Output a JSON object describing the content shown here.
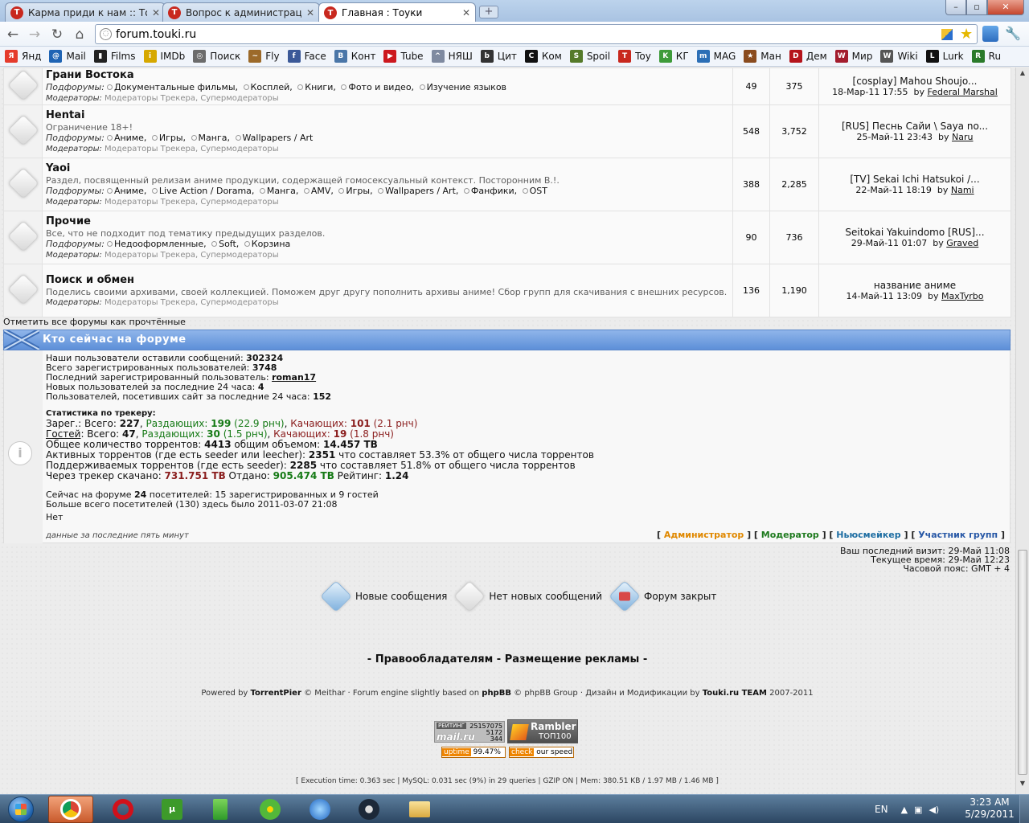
{
  "browser": {
    "tabs": [
      {
        "title": "Карма приди к нам :: То...",
        "favicon": "T"
      },
      {
        "title": "Вопрос к администраци...",
        "favicon": "T"
      },
      {
        "title": "Главная : Тоуки",
        "favicon": "T"
      }
    ],
    "new_tab": "+",
    "window_buttons": {
      "minimize": "–",
      "maximize": "▫",
      "close": "✕"
    },
    "nav": {
      "back": "←",
      "forward": "→",
      "reload": "↻",
      "home": "⌂"
    },
    "address": "forum.touki.ru",
    "bookmarks": [
      {
        "label": "Янд",
        "icon": "Я",
        "color": "#e53b2c"
      },
      {
        "label": "Mail",
        "icon": "@",
        "color": "#1f64b4"
      },
      {
        "label": "Films",
        "icon": "▮",
        "color": "#222222"
      },
      {
        "label": "IMDb",
        "icon": "i",
        "color": "#d6a800"
      },
      {
        "label": "Поиск",
        "icon": "◎",
        "color": "#6c6c6c"
      },
      {
        "label": "Fly",
        "icon": "~",
        "color": "#9c6a2a"
      },
      {
        "label": "Face",
        "icon": "f",
        "color": "#3b5998"
      },
      {
        "label": "Конт",
        "icon": "В",
        "color": "#4a76a8"
      },
      {
        "label": "Tube",
        "icon": "▶",
        "color": "#cc181e"
      },
      {
        "label": "НЯШ",
        "icon": "^",
        "color": "#7f8aa0"
      },
      {
        "label": "Цит",
        "icon": "b",
        "color": "#333333"
      },
      {
        "label": "Ком",
        "icon": "C",
        "color": "#111111"
      },
      {
        "label": "Spoil",
        "icon": "S",
        "color": "#557a2a"
      },
      {
        "label": "Toy",
        "icon": "T",
        "color": "#c8281e"
      },
      {
        "label": "КГ",
        "icon": "K",
        "color": "#3e9b3a"
      },
      {
        "label": "MAG",
        "icon": "m",
        "color": "#2c6fb6"
      },
      {
        "label": "Ман",
        "icon": "★",
        "color": "#8a4b1e"
      },
      {
        "label": "Дем",
        "icon": "D",
        "color": "#b5141b"
      },
      {
        "label": "Мир",
        "icon": "W",
        "color": "#a31d2e"
      },
      {
        "label": "Wiki",
        "icon": "W",
        "color": "#555555"
      },
      {
        "label": "Lurk",
        "icon": "L",
        "color": "#111111"
      },
      {
        "label": "Ru",
        "icon": "R",
        "color": "#2a7a2a"
      }
    ]
  },
  "forums": [
    {
      "title": "Грани Востока",
      "desc": "",
      "subforums_label": "Подфорумы:",
      "subforums": [
        "Документальные фильмы,",
        "Косплей,",
        "Книги,",
        "Фото и видео,",
        "Изучение языков"
      ],
      "mods_label": "Модераторы:",
      "mods": "Модераторы Трекера, Супермодераторы",
      "topics": "49",
      "posts": "375",
      "last_title": "[cosplay] Mahou Shoujo...",
      "last_date": "18-Мар-11 17:55",
      "by": "by",
      "last_user": "Federal Marshal"
    },
    {
      "title": "Hentai",
      "desc": "Ограничение 18+!",
      "subforums_label": "Подфорумы:",
      "subforums": [
        "Аниме,",
        "Игры,",
        "Манга,",
        "Wallpapers / Art"
      ],
      "mods_label": "Модераторы:",
      "mods": "Модераторы Трекера, Супермодераторы",
      "topics": "548",
      "posts": "3,752",
      "last_title": "[RUS] Песнь Сайи \\ Saya no...",
      "last_date": "25-Май-11 23:43",
      "by": "by",
      "last_user": "Naru"
    },
    {
      "title": "Yaoi",
      "desc": "Раздел, посвященный релизам аниме продукции, содержащей гомосексуальный контекст. Посторонним В.!.",
      "subforums_label": "Подфорумы:",
      "subforums": [
        "Аниме,",
        "Live Action / Dorama,",
        "Манга,",
        "AMV,",
        "Игры,",
        "Wallpapers / Art,",
        "Фанфики,",
        "OST"
      ],
      "mods_label": "Модераторы:",
      "mods": "Модераторы Трекера, Супермодераторы",
      "topics": "388",
      "posts": "2,285",
      "last_title": "[TV] Sekai Ichi Hatsukoi /...",
      "last_date": "22-Май-11 18:19",
      "by": "by",
      "last_user": "Nami"
    },
    {
      "title": "Прочие",
      "desc": "Все, что не подходит под тематику предыдущих разделов.",
      "subforums_label": "Подфорумы:",
      "subforums": [
        "Недооформленные,",
        "Soft,",
        "Корзина"
      ],
      "mods_label": "Модераторы:",
      "mods": "Модераторы Трекера, Супермодераторы",
      "topics": "90",
      "posts": "736",
      "last_title": "Seitokai Yakuindomo [RUS]...",
      "last_date": "29-Май-11 01:07",
      "by": "by",
      "last_user": "Graved"
    },
    {
      "title": "Поиск и обмен",
      "desc": "Поделись своими архивами, своей коллекцией. Поможем друг другу пополнить архивы аниме! Сбор групп для скачивания с внешних ресурсов.",
      "subforums_label": "",
      "subforums": [],
      "mods_label": "Модераторы:",
      "mods": "Модераторы Трекера, Супермодераторы",
      "topics": "136",
      "posts": "1,190",
      "last_title": "название аниме",
      "last_date": "14-Май-11 13:09",
      "by": "by",
      "last_user": "MaxTyrbo"
    }
  ],
  "mark_all_read": "Отметить все форумы как прочтённые",
  "online": {
    "header": "Кто сейчас на форуме",
    "stats": [
      {
        "label": "Наши пользователи оставили сообщений: ",
        "value": "302324"
      },
      {
        "label": "Всего зарегистрированных пользователей: ",
        "value": "3748"
      },
      {
        "label": "Последний зарегистрированный пользователь: ",
        "value": "roman17"
      },
      {
        "label": "Новых пользователей за последние 24 часа: ",
        "value": "4"
      },
      {
        "label": "Пользователей, посетивших сайт за последние 24 часа: ",
        "value": "152"
      }
    ],
    "tracker_title": "Статистика по трекеру:",
    "reg": {
      "label": "Зарег.:",
      "total_label": " Всего: ",
      "total": "227",
      "seed_label": "Раздающих: ",
      "seed": "199",
      "seed_rate": "(22.9 рнч)",
      "leech_label": "Качающих: ",
      "leech": "101",
      "leech_rate": "(2.1 рнч)"
    },
    "guests": {
      "label": "Гостей",
      "total_label": ": Всего: ",
      "total": "47",
      "seed_label": "Раздающих: ",
      "seed": "30",
      "seed_rate": "(1.5 рнч)",
      "leech_label": "Качающих: ",
      "leech": "19",
      "leech_rate": "(1.8 рнч)"
    },
    "torrents": {
      "label": "Общее количество торрентов: ",
      "value": "4413",
      "volume_label": " общим объемом: ",
      "volume": "14.457 TB"
    },
    "active": {
      "label": "Активных торрентов (где есть seeder или leecher): ",
      "value": "2351",
      "rest": " что составляет 53.3% от общего числа торрентов"
    },
    "seeded": {
      "label": "Поддерживаемых торрентов (где есть seeder): ",
      "value": "2285",
      "rest": " что составляет 51.8% от общего числа торрентов"
    },
    "traffic": {
      "down_label": "Через трекер скачано: ",
      "down": "731.751 TB",
      "up_label": " Отдано: ",
      "up": "905.474 TB",
      "ratio_label": " Рейтинг: ",
      "ratio": "1.24"
    },
    "now_label": "Сейчас на форуме ",
    "now_count": "24",
    "now_rest": " посетителей: 15 зарегистрированных и 9 гостей",
    "max": "Больше всего посетителей (130) здесь было 2011-03-07 21:08",
    "none": "Нет",
    "last5": "данные за последние пять минут",
    "legend": {
      "admin": "Администратор",
      "mod": "Модератор",
      "news": "Ньюсмейкер",
      "group": "Участник групп"
    }
  },
  "times": {
    "last_visit": "Ваш последний визит: 29-Май 11:08",
    "now": "Текущее время: 29-Май 12:23",
    "tz": "Часовой пояс: GMT + 4"
  },
  "icon_legend": {
    "new": "Новые сообщения",
    "no_new": "Нет новых сообщений",
    "locked": "Форум закрыт"
  },
  "footer": {
    "dash": "-",
    "link1": "Правообладателям",
    "link2": "Размещение рекламы",
    "powered_1": "Powered by ",
    "powered_tp": "TorrentPier",
    "powered_2": " © Meithar · Forum engine slightly based on ",
    "powered_phpbb": "phpBB",
    "powered_3": " © phpBB Group · Дизайн и Модификации by ",
    "powered_team": "Touki.ru TEAM",
    "powered_4": " 2007-2011",
    "exec": "[  Execution time: 0.363 sec  |  MySQL: 0.031 sec (9%) in 29 queries  |  GZIP ON  |  Mem: 380.51 KB / 1.97 MB / 1.46 MB  ]"
  },
  "counters": {
    "mail_rating_label": "РЕЙТИНГ",
    "mail_rating": "25157075",
    "mail_logo": "mail.ru",
    "mail_v2": "5172",
    "mail_v3": "344",
    "rambler": "Rambler",
    "rambler_top": "ТОП100",
    "uptime_label": "uptime",
    "uptime": "99.47%",
    "check_label": "check",
    "check_rest": "our speed"
  },
  "taskbar": {
    "lang": "EN",
    "time": "3:23 AM",
    "date": "5/29/2011"
  }
}
